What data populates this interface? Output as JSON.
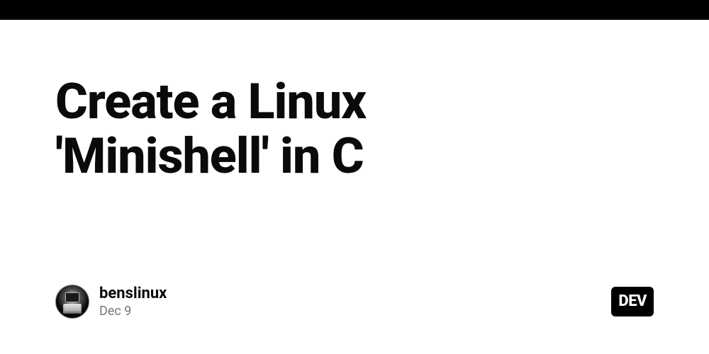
{
  "article": {
    "title": "Create a Linux 'Minishell' in C"
  },
  "author": {
    "username": "benslinux",
    "date": "Dec 9"
  },
  "badge": {
    "label": "DEV"
  }
}
